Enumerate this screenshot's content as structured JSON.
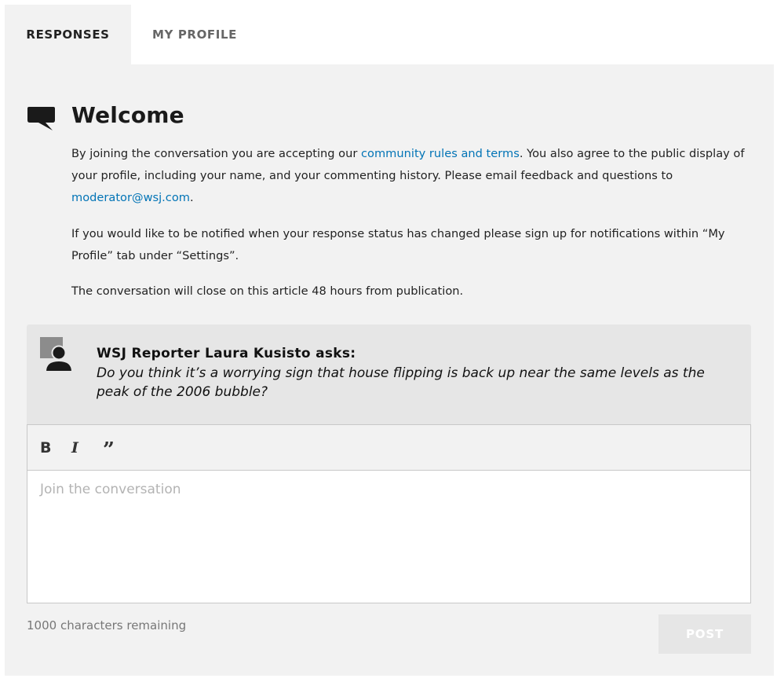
{
  "tabs": [
    {
      "label": "RESPONSES",
      "active": true
    },
    {
      "label": "MY PROFILE",
      "active": false
    }
  ],
  "welcome": {
    "title": "Welcome",
    "icon": "speech-bubble-icon",
    "p1_before_link": "By joining the conversation you are accepting our ",
    "p1_link": "community rules and terms",
    "p1_after_link": ". You also agree to the public display of your profile, including your name, and your commenting history. Please email feedback and questions to ",
    "p1_email": "moderator@wsj.com",
    "p1_end": ".",
    "p2": "If you would like to be notified when your response status has changed please sign up for notifications within “My Profile” tab under “Settings”.",
    "p3": "The conversation will close on this article 48 hours from publication."
  },
  "question": {
    "icon": "reporter-avatar-icon",
    "header": "WSJ Reporter Laura Kusisto asks:",
    "text": "Do you think it’s a worrying sign that house flipping is back up near the same levels as the peak of the 2006 bubble?"
  },
  "editor": {
    "toolbar": {
      "bold": "B",
      "italic": "I",
      "quote": "”"
    },
    "placeholder": "Join the conversation",
    "value": ""
  },
  "footer": {
    "chars_remaining": "1000 characters remaining",
    "post_label": "POST"
  },
  "colors": {
    "link": "#0274b6",
    "panel_bg": "#f2f2f2",
    "question_bg": "#e6e6e6",
    "post_disabled_bg": "#e6e6e6"
  }
}
